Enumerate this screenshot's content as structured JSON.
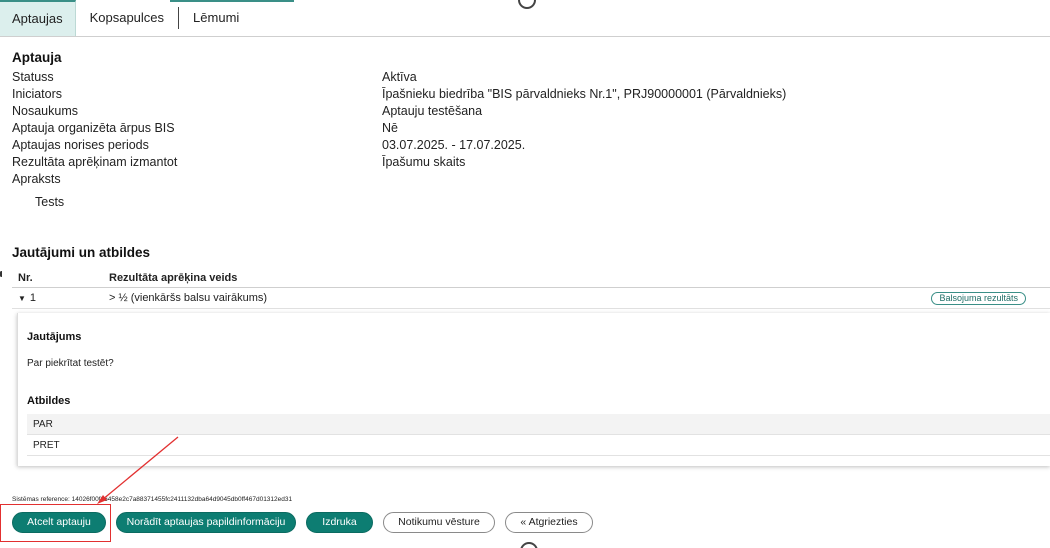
{
  "tabs": [
    {
      "label": "Aptaujas"
    },
    {
      "label": "Kopsapulces"
    },
    {
      "label": "Lēmumi"
    }
  ],
  "survey": {
    "title": "Aptauja",
    "fields": [
      {
        "label": "Statuss",
        "value": "Aktīva"
      },
      {
        "label": "Iniciators",
        "value": "Īpašnieku biedrība \"BIS pārvaldnieks Nr.1\", PRJ90000001 (Pārvaldnieks)"
      },
      {
        "label": "Nosaukums",
        "value": "Aptauju testēšana"
      },
      {
        "label": "Aptauja organizēta ārpus BIS",
        "value": "Nē"
      },
      {
        "label": "Aptaujas norises periods",
        "value": "03.07.2025. - 17.07.2025."
      },
      {
        "label": "Rezultāta aprēķinam izmantot",
        "value": "Īpašumu skaits"
      },
      {
        "label": "Apraksts",
        "value": ""
      }
    ],
    "description": "Tests"
  },
  "questions": {
    "title": "Jautājumi un atbildes",
    "columns": [
      "Nr.",
      "Rezultāta aprēķina veids"
    ],
    "rows": [
      {
        "nr": "1",
        "type": "> ½ (vienkāršs balsu vairākums)",
        "result_button": "Balsojuma rezultāts"
      }
    ],
    "detail": {
      "question_heading": "Jautājums",
      "question_text": "Par piekrītat testēt?",
      "answers_heading": "Atbildes",
      "answers": [
        "PAR",
        "PRET"
      ]
    }
  },
  "system_reference": "Sistēmas reference: 14026f00f16458e2c7a88371455fc2411132dba64d9045db0ff467d01312ed31",
  "buttons": {
    "cancel": "Atcelt aptauju",
    "show_info": "Norādīt aptaujas papildinformāciju",
    "print": "Izdruka",
    "history": "Notikumu vēsture",
    "back": "« Atgriezties"
  },
  "colors": {
    "primary": "#0d7d72",
    "tab_active_bg": "#dcefed",
    "annotation": "#e23030"
  }
}
